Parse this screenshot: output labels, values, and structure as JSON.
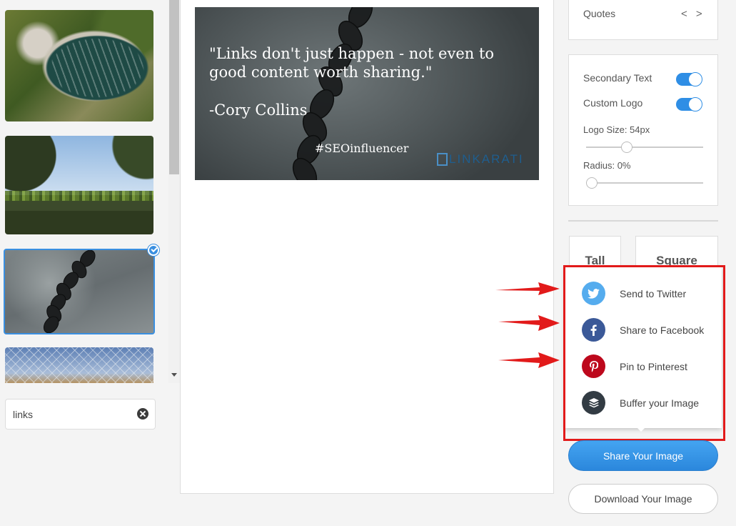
{
  "preview": {
    "quote": "\"Links don't just happen - not even to good content worth sharing.\"",
    "author": "-Cory Collins",
    "hashtag": "#SEOinfluencer",
    "logo_text": "LINKARATI"
  },
  "sidebar": {
    "search_value": "links",
    "thumbnails": [
      "harbor-aerial",
      "vineyard-sky",
      "chain-concrete",
      "chain-fence"
    ],
    "selected_thumbnail": 2
  },
  "panel": {
    "quotes_label": "Quotes",
    "quotes_nav": "< >",
    "secondary_text_label": "Secondary Text",
    "secondary_text_on": true,
    "custom_logo_label": "Custom Logo",
    "custom_logo_on": true,
    "logo_size_label": "Logo Size: 54px",
    "logo_size_fraction": 0.33,
    "radius_label": "Radius: 0%",
    "radius_fraction": 0.0,
    "format_tall": "Tall",
    "format_square": "Square"
  },
  "share_menu": {
    "items": [
      {
        "label": "Send to Twitter",
        "icon": "twitter-icon",
        "color": "#55acee"
      },
      {
        "label": "Share to Facebook",
        "icon": "facebook-icon",
        "color": "#3b5998"
      },
      {
        "label": "Pin to Pinterest",
        "icon": "pinterest-icon",
        "color": "#bd081c"
      },
      {
        "label": "Buffer your Image",
        "icon": "buffer-icon",
        "color": "#323b43"
      }
    ]
  },
  "actions": {
    "share_label": "Share Your Image",
    "download_label": "Download Your Image"
  },
  "colors": {
    "accent": "#2f8ee5",
    "highlight": "#e21a1a"
  }
}
